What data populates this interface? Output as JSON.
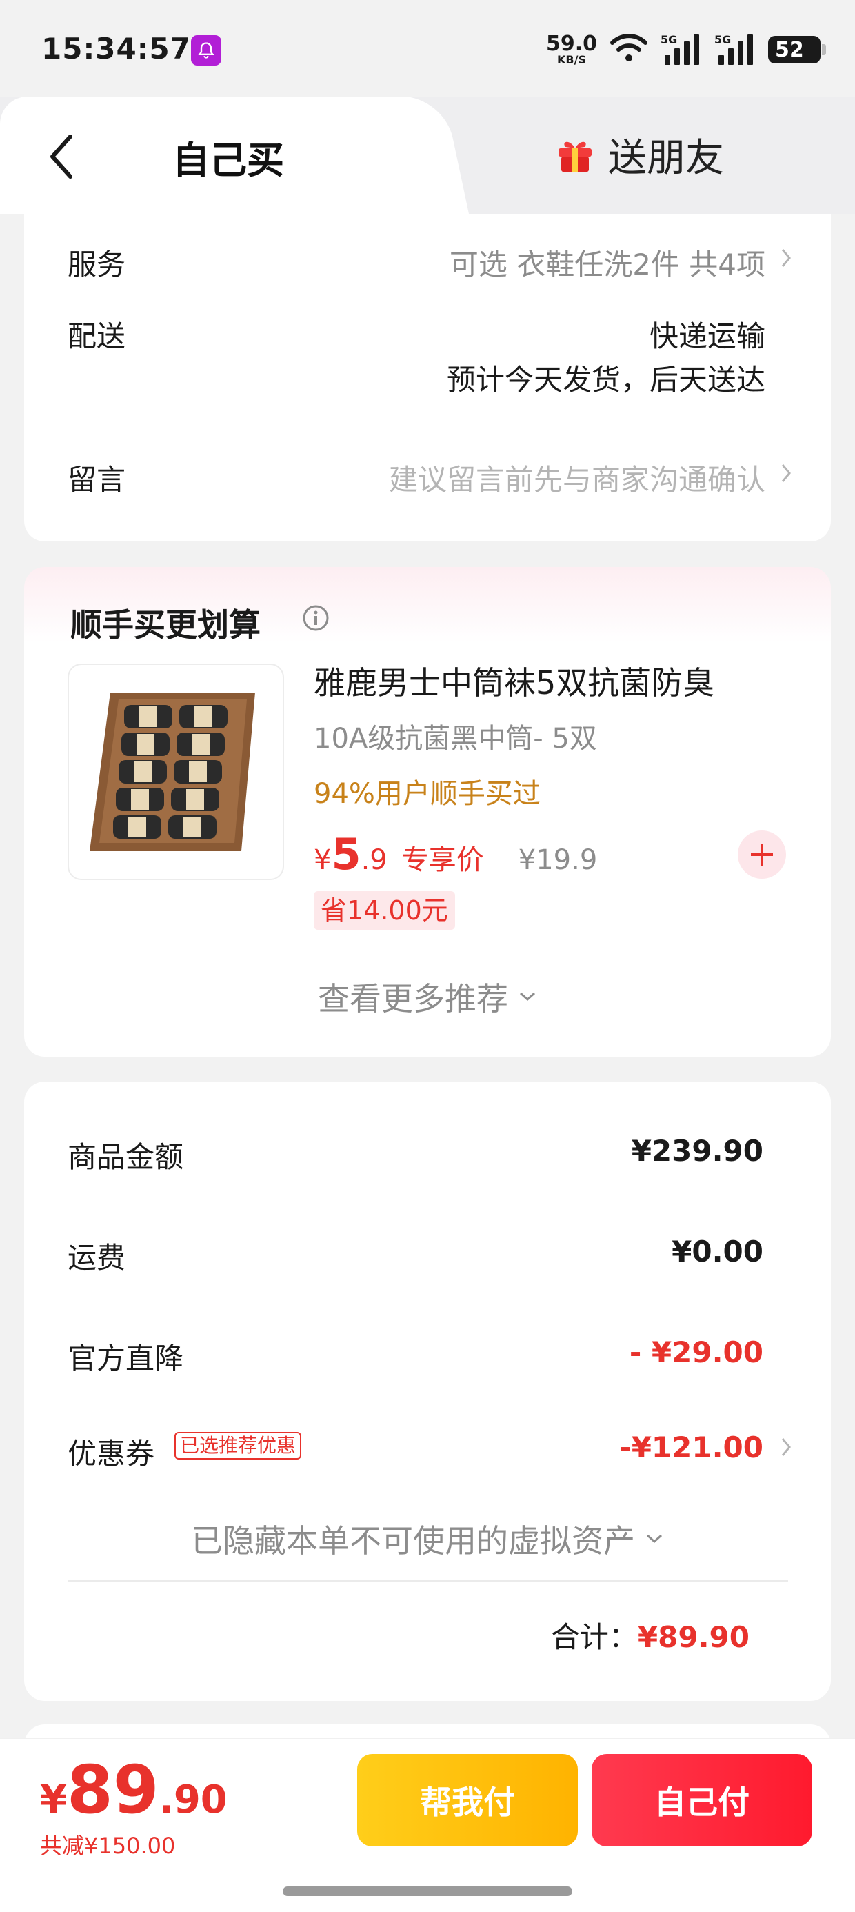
{
  "status_bar": {
    "time": "15:34:57",
    "net_speed": "59.0",
    "net_unit": "KB/S",
    "signal_1_label": "5G",
    "signal_2_label": "5G",
    "battery": "52"
  },
  "tabs": {
    "self_buy": "自己买",
    "gift_friend": "送朋友"
  },
  "order_info": {
    "service_label": "服务",
    "service_value": "可选 衣鞋任洗2件 共4项",
    "delivery_label": "配送",
    "delivery_method": "快递运输",
    "delivery_eta": "预计今天发货，后天送达",
    "note_label": "留言",
    "note_placeholder": "建议留言前先与商家沟通确认"
  },
  "upsell": {
    "title": "顺手买更划算",
    "product": {
      "name": "雅鹿男士中筒袜5双抗菌防臭",
      "spec": "10A级抗菌黑中筒- 5双",
      "social_proof": "94%用户顺手买过",
      "price_symbol": "¥",
      "price_int": "5",
      "price_dec": ".9",
      "price_tag": "专享价",
      "original_price": "¥19.9",
      "save_badge": "省14.00元"
    },
    "more_label": "查看更多推荐"
  },
  "summary": {
    "goods_amount_label": "商品金额",
    "goods_amount": "¥239.90",
    "shipping_label": "运费",
    "shipping": "¥0.00",
    "official_discount_label": "官方直降",
    "official_discount": "- ¥29.00",
    "coupon_label": "优惠券",
    "coupon_badge": "已选推荐优惠",
    "coupon_value": "-¥121.00",
    "hidden_assets": "已隐藏本单不可使用的虚拟资产",
    "total_label": "合计：",
    "total_value": "¥89.90"
  },
  "bottom_bar": {
    "pay_symbol": "¥",
    "pay_int": "89",
    "pay_dec": ".90",
    "discount_text": "共减¥150.00",
    "help_pay_button": "帮我付",
    "self_pay_button": "自己付"
  },
  "colors": {
    "accent_red": "#e8322c",
    "social_orange": "#c8821a",
    "help_button_yellow": "#ffc107",
    "pay_button_red": "#ff2a3c"
  }
}
